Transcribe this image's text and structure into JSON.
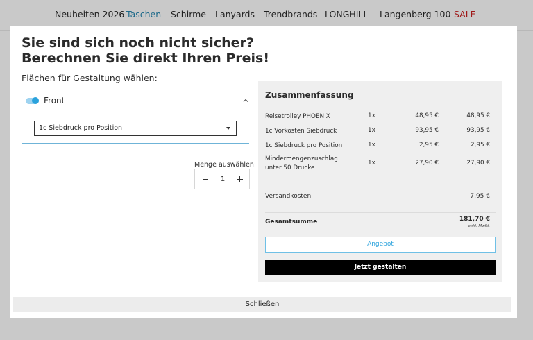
{
  "nav": {
    "items": [
      {
        "label": "Neuheiten 2026"
      },
      {
        "label": "Taschen"
      },
      {
        "label": "Schirme"
      },
      {
        "label": "Lanyards"
      },
      {
        "label": "Trendbrands"
      },
      {
        "label": "LONGHILL"
      },
      {
        "label": "Langenberg 100"
      },
      {
        "label": "SALE"
      }
    ],
    "active_color": "#1e6a8a",
    "sale_color": "#a01818"
  },
  "modal": {
    "title_line1": "Sie sind sich noch nicht sicher?",
    "title_line2": "Berechnen Sie direkt Ihren Preis!",
    "areas_label": "Flächen für Gestaltung wählen:",
    "front": {
      "label": "Front",
      "toggle_on": true
    },
    "select": {
      "value": "1c Siebdruck pro Position"
    },
    "quantity": {
      "label": "Menge auswählen:",
      "value": "1"
    },
    "close_label": "Schließen"
  },
  "summary": {
    "title": "Zusammenfassung",
    "rows": [
      {
        "name": "Reisetrolley PHOENIX",
        "count": "1x",
        "price": "48,95 €",
        "total": "48,95 €"
      },
      {
        "name": "1c Vorkosten Siebdruck",
        "count": "1x",
        "price": "93,95 €",
        "total": "93,95 €"
      },
      {
        "name": "1c Siebdruck pro Position",
        "count": "1x",
        "price": "2,95 €",
        "total": "2,95 €"
      },
      {
        "name": "Mindermengenzuschlag unter 50 Drucke",
        "count": "1x",
        "price": "27,90 €",
        "total": "27,90 €"
      }
    ],
    "shipping_label": "Versandkosten",
    "shipping_value": "7,95 €",
    "grand_label": "Gesamtsumme",
    "grand_value": "181,70 €",
    "grand_note": "exkl. MwSt.",
    "offer_button": "Angebot",
    "create_button": "Jetzt gestalten",
    "accent_color": "#2aa2dc"
  }
}
